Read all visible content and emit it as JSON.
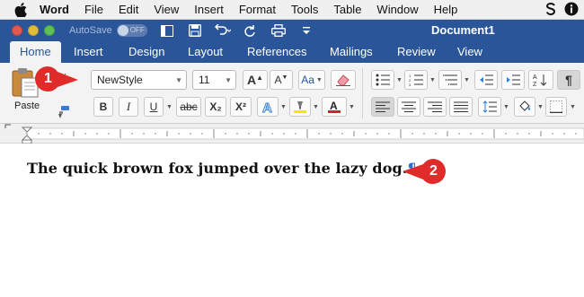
{
  "menubar": {
    "app_name": "Word",
    "items": [
      "File",
      "Edit",
      "View",
      "Insert",
      "Format",
      "Tools",
      "Table",
      "Window",
      "Help"
    ]
  },
  "titlebar": {
    "autosave_label": "AutoSave",
    "autosave_state": "OFF",
    "document_title": "Document1"
  },
  "tabs": [
    {
      "label": "Home",
      "active": true
    },
    {
      "label": "Insert",
      "active": false
    },
    {
      "label": "Design",
      "active": false
    },
    {
      "label": "Layout",
      "active": false
    },
    {
      "label": "References",
      "active": false
    },
    {
      "label": "Mailings",
      "active": false
    },
    {
      "label": "Review",
      "active": false
    },
    {
      "label": "View",
      "active": false
    }
  ],
  "ribbon": {
    "paste_label": "Paste",
    "style_value": "NewStyle",
    "font_size_value": "11",
    "bold": "B",
    "italic": "I",
    "underline": "U",
    "strikethrough": "abc",
    "subscript": "X₂",
    "superscript": "X²",
    "pilcrow_btn": "¶"
  },
  "document": {
    "text": "The quick brown fox jumped over the lazy dog.",
    "pilcrow": "¶"
  },
  "callouts": {
    "first": "1",
    "second": "2"
  },
  "colors": {
    "title_blue": "#2a5699",
    "callout_red": "#e02b2b",
    "pilcrow_blue": "#2d6fd1"
  }
}
